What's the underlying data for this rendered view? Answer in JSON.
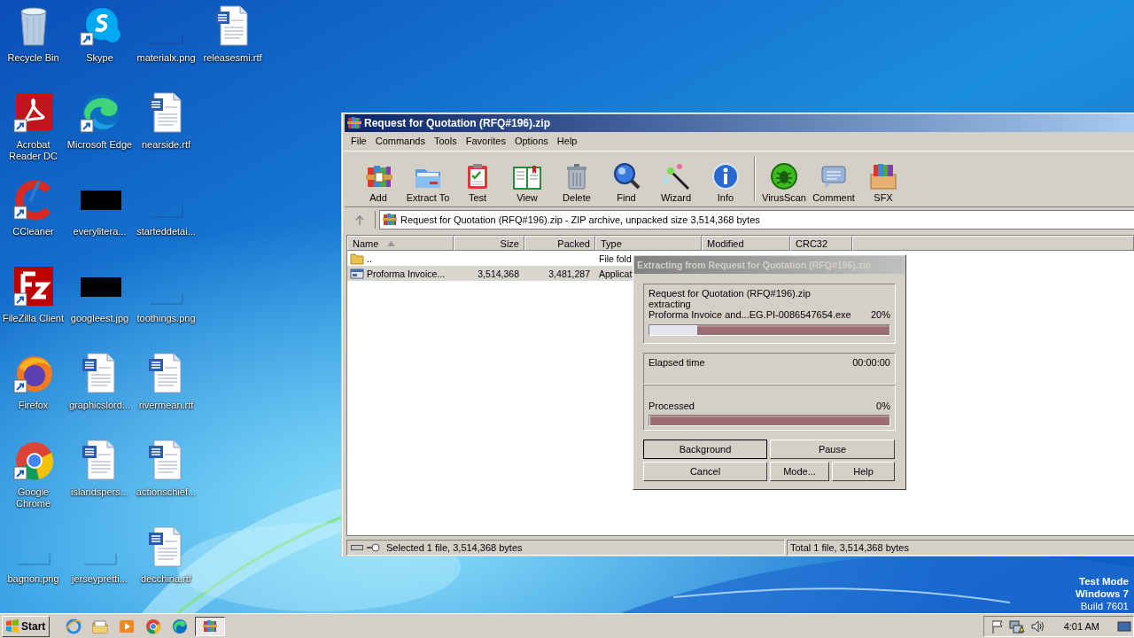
{
  "desktop": {
    "icons": [
      {
        "label": "Recycle Bin",
        "shortcut": false
      },
      {
        "label": "Acrobat Reader DC",
        "shortcut": true
      },
      {
        "label": "CCleaner",
        "shortcut": true
      },
      {
        "label": "FileZilla Client",
        "shortcut": true
      },
      {
        "label": "Firefox",
        "shortcut": true
      },
      {
        "label": "Google Chrome",
        "shortcut": true
      },
      {
        "label": "bagnon.png",
        "shortcut": false
      },
      {
        "label": "Skype",
        "shortcut": true
      },
      {
        "label": "Microsoft Edge",
        "shortcut": true
      },
      {
        "label": "everylitera...",
        "shortcut": false
      },
      {
        "label": "googleest.jpg",
        "shortcut": false
      },
      {
        "label": "graphicslord...",
        "shortcut": false
      },
      {
        "label": "islandspers...",
        "shortcut": false
      },
      {
        "label": "jerseypretti...",
        "shortcut": false
      },
      {
        "label": "materialx.png",
        "shortcut": false
      },
      {
        "label": "nearside.rtf",
        "shortcut": false
      },
      {
        "label": "starteddetai...",
        "shortcut": false
      },
      {
        "label": "toothings.png",
        "shortcut": false
      },
      {
        "label": "rivermean.rtf",
        "shortcut": false
      },
      {
        "label": "actionschief...",
        "shortcut": false
      },
      {
        "label": "decchina.rtf",
        "shortcut": false
      },
      {
        "label": "releasesmi.rtf",
        "shortcut": false
      }
    ],
    "os_notice": [
      "Test Mode",
      "Windows 7",
      "Build 7601"
    ]
  },
  "archiver": {
    "title": "Request for Quotation (RFQ#196).zip",
    "active": true,
    "menu": [
      "File",
      "Commands",
      "Tools",
      "Favorites",
      "Options",
      "Help"
    ],
    "toolbar": [
      {
        "kind": "button",
        "label": "Add"
      },
      {
        "kind": "button",
        "label": "Extract To"
      },
      {
        "kind": "button",
        "label": "Test"
      },
      {
        "kind": "button",
        "label": "View"
      },
      {
        "kind": "button",
        "label": "Delete"
      },
      {
        "kind": "button",
        "label": "Find"
      },
      {
        "kind": "button",
        "label": "Wizard"
      },
      {
        "kind": "button",
        "label": "Info"
      },
      {
        "kind": "separator"
      },
      {
        "kind": "button",
        "label": "VirusScan"
      },
      {
        "kind": "button",
        "label": "Comment"
      },
      {
        "kind": "button",
        "label": "SFX"
      }
    ],
    "address": "Request for Quotation (RFQ#196).zip - ZIP archive, unpacked size 3,514,368 bytes",
    "file_list": {
      "columns": [
        {
          "label": "Name",
          "sorted": true
        },
        {
          "label": "Size",
          "sorted": false
        },
        {
          "label": "Packed",
          "sorted": false
        },
        {
          "label": "Type",
          "sorted": false
        },
        {
          "label": "Modified",
          "sorted": false
        },
        {
          "label": "CRC32",
          "sorted": false
        }
      ],
      "rows": [
        {
          "kind": "folder",
          "name": "..",
          "type": "File fold",
          "selected": false
        },
        {
          "kind": "file",
          "name": "Proforma Invoice...",
          "size": "3,514,368",
          "packed": "3,481,287",
          "type": "Applicat",
          "selected": true
        }
      ]
    },
    "status_bar": {
      "left": "Selected 1 file, 3,514,368 bytes",
      "right": "Total 1 file, 3,514,368 bytes"
    }
  },
  "dialog": {
    "title": "Extracting from Request for Quotation (RFQ#196).zip",
    "active": false,
    "archive": "Request for Quotation (RFQ#196).zip",
    "action": "extracting",
    "file": "Proforma Invoice and...EG.PI-0086547654.exe",
    "file_percent": "20%",
    "file_progress": {
      "level": 0.2
    },
    "elapsed_label": "Elapsed time",
    "elapsed": "00:00:00",
    "processed_label": "Processed",
    "processed_percent": "0%",
    "processed_progress": {
      "level": 0
    },
    "buttons": [
      {
        "label": "Background",
        "default": true
      },
      {
        "label": "Pause",
        "default": false
      },
      {
        "label": "Cancel",
        "default": false
      },
      {
        "label": "Mode...",
        "default": false
      },
      {
        "label": "Help",
        "default": false
      }
    ]
  },
  "taskbar": {
    "start": "Start",
    "apps": [
      {
        "selected": false
      },
      {
        "selected": false
      },
      {
        "selected": false
      },
      {
        "selected": false
      },
      {
        "selected": false
      },
      {
        "selected": true
      }
    ],
    "clock": "4:01 AM"
  }
}
